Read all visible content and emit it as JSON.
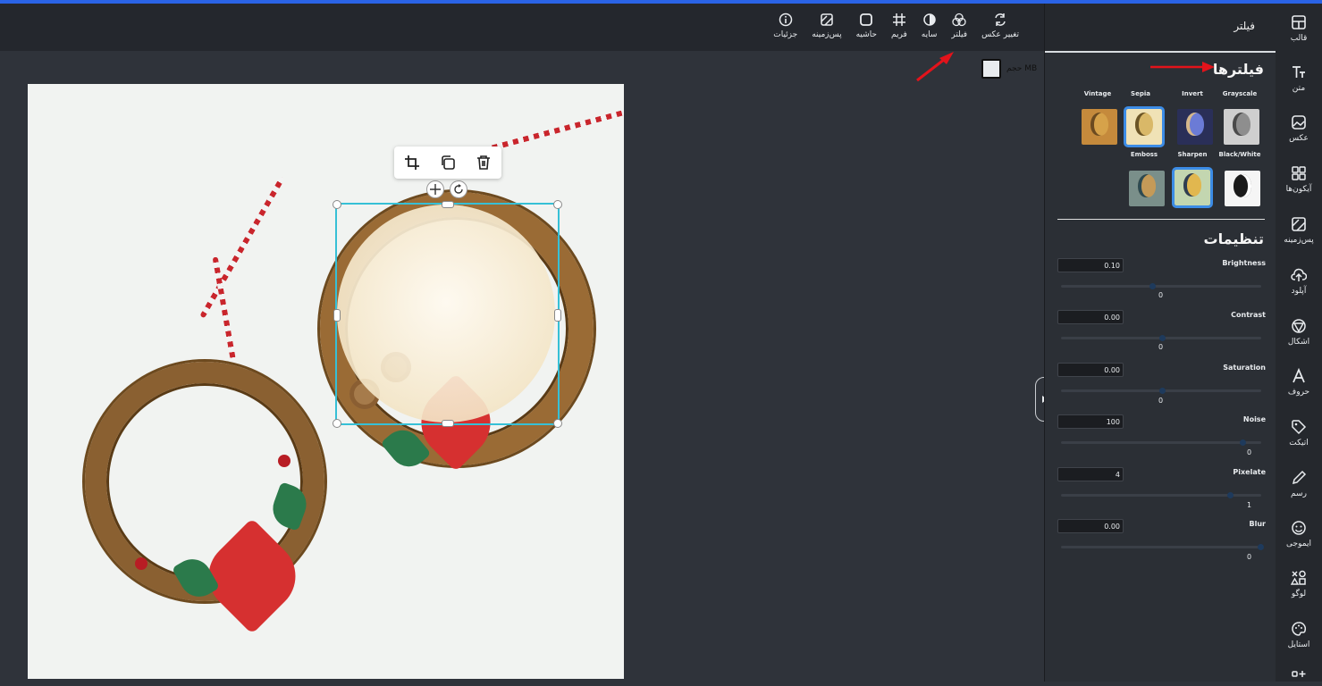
{
  "toolbar": {
    "items": [
      {
        "label": "جزئیات",
        "icon": "info-icon"
      },
      {
        "label": "پس‌زمینه",
        "icon": "background-icon"
      },
      {
        "label": "حاشیه",
        "icon": "border-icon"
      },
      {
        "label": "فریم",
        "icon": "frame-icon"
      },
      {
        "label": "سایه",
        "icon": "shadow-icon"
      },
      {
        "label": "فیلتر",
        "icon": "filter-icon"
      },
      {
        "label": "تغییر عکس",
        "icon": "replace-image-icon"
      }
    ],
    "size_label": "حجم MB"
  },
  "panel": {
    "title": "فیلتر",
    "filters_title": "فیلترها",
    "filters_row1": [
      {
        "label": "Vintage",
        "selected": false,
        "bg": "#c58a3c",
        "fg": "#d6a24a"
      },
      {
        "label": "Sepia",
        "selected": true,
        "bg": "#f0e2b6",
        "fg": "#d9b868"
      },
      {
        "label": "Invert",
        "selected": false,
        "bg": "#2a2f58",
        "fg": "#6b7bd6"
      },
      {
        "label": "Grayscale",
        "selected": false,
        "bg": "#cfcfcf",
        "fg": "#8e8e8e"
      }
    ],
    "filters_row2": [
      {
        "label": "Emboss",
        "selected": false,
        "bg": "#7a8f8a",
        "fg": "#c49a58"
      },
      {
        "label": "Sharpen",
        "selected": true,
        "bg": "#c3d6b0",
        "fg": "#e1b74f"
      },
      {
        "label": "Black/White",
        "selected": false,
        "bg": "#f5f5f5",
        "fg": "#1a1a1a"
      }
    ],
    "settings_title": "تنظیمات",
    "settings": [
      {
        "label": "Brightness",
        "value": "0.10",
        "sub": "0",
        "level": 0.45
      },
      {
        "label": "Contrast",
        "value": "0.00",
        "sub": "0",
        "level": 0.5
      },
      {
        "label": "Saturation",
        "value": "0.00",
        "sub": "0",
        "level": 0.5
      },
      {
        "label": "Noise",
        "value": "100",
        "sub": "0",
        "level": 0.9
      },
      {
        "label": "Pixelate",
        "value": "4",
        "sub": "1",
        "level": 0.85
      },
      {
        "label": "Blur",
        "value": "0.00",
        "sub": "0",
        "level": 1.0
      }
    ]
  },
  "sidebar": {
    "items": [
      {
        "label": "قالب",
        "icon": "template-icon"
      },
      {
        "label": "متن",
        "icon": "text-icon"
      },
      {
        "label": "عکس",
        "icon": "image-icon"
      },
      {
        "label": "آیکون‌ها",
        "icon": "icons-icon"
      },
      {
        "label": "پس‌زمینه",
        "icon": "background-icon"
      },
      {
        "label": "آپلود",
        "icon": "upload-icon"
      },
      {
        "label": "اشکال",
        "icon": "shapes-icon"
      },
      {
        "label": "حروف",
        "icon": "letters-icon"
      },
      {
        "label": "اتیکت",
        "icon": "sticker-icon"
      },
      {
        "label": "رسم",
        "icon": "draw-icon"
      },
      {
        "label": "ایموجی",
        "icon": "emoji-icon"
      },
      {
        "label": "لوگو",
        "icon": "logo-icon"
      },
      {
        "label": "استایل",
        "icon": "palette-icon"
      }
    ]
  },
  "colors": {
    "accent": "#2a63e6",
    "selection": "#36c0d6",
    "annotation_arrow": "#e3131b"
  }
}
